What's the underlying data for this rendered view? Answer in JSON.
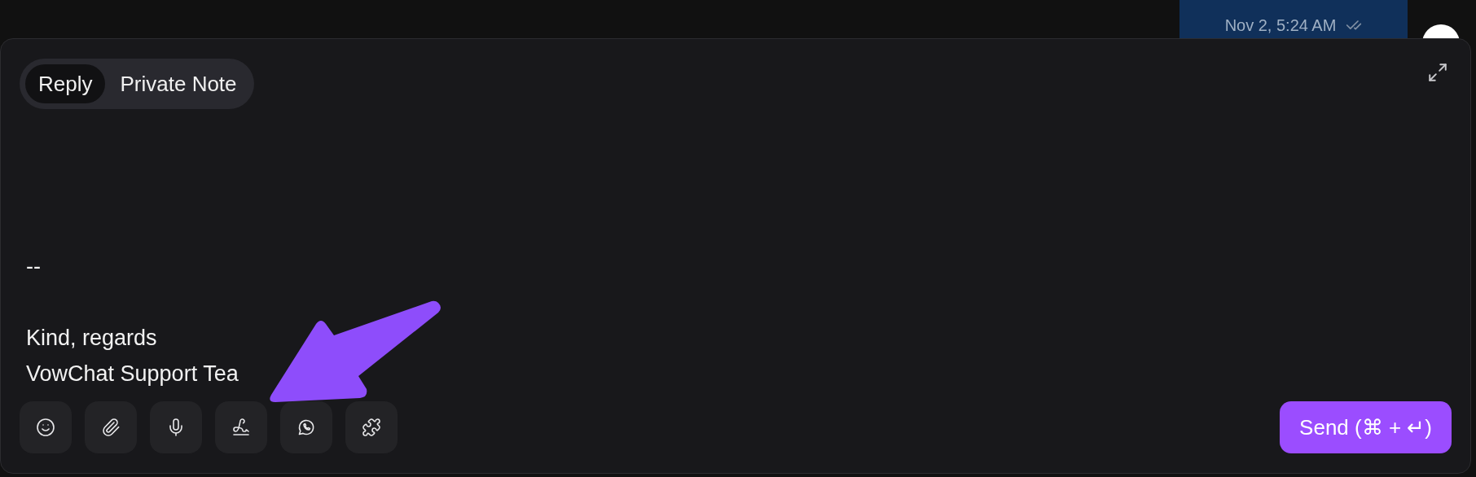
{
  "message": {
    "time": "Nov 2, 5:24 AM"
  },
  "tabs": [
    {
      "label": "Reply",
      "selected": true
    },
    {
      "label": "Private Note",
      "selected": false
    }
  ],
  "editor": {
    "paragraphs": [
      [
        "--"
      ],
      [
        "Kind, regards",
        "VowChat Support Tea"
      ]
    ]
  },
  "send_button": {
    "label": "Send (⌘ + ↵)"
  }
}
